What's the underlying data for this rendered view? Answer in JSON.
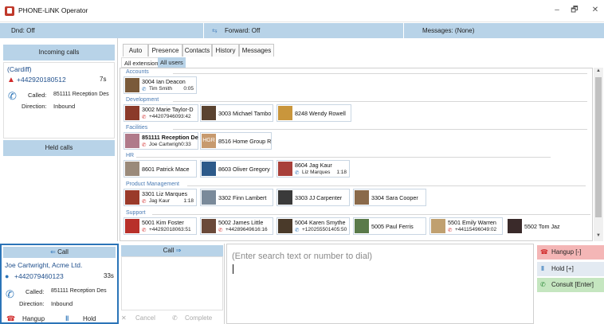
{
  "window": {
    "title": "PHONE-LiNK Operator",
    "minimize": "–",
    "maximize": "🗗",
    "close": "✕"
  },
  "status": {
    "dnd": "Dnd: Off",
    "forward": "Forward: Off",
    "messages": "Messages: (None)"
  },
  "left": {
    "incoming_header": "Incoming calls",
    "incoming": {
      "name": "(Cardiff)",
      "number": "+442920180512",
      "time": "7s",
      "called_label": "Called:",
      "called_value": "851111 Reception Des",
      "direction_label": "Direction:",
      "direction_value": "Inbound"
    },
    "held_header": "Held calls"
  },
  "tabs": [
    "Auto",
    "Presence",
    "Contacts",
    "History",
    "Messages"
  ],
  "subtabs": [
    "All extensions",
    "All users"
  ],
  "groups": [
    {
      "name": "Accounts",
      "users": [
        {
          "ext": "3004",
          "name": "Ian Deacon",
          "sub": "Tim Smith",
          "dur": "0:05"
        }
      ]
    },
    {
      "name": "Development",
      "users": [
        {
          "ext": "3002",
          "name": "Marie Taylor-D",
          "sub": "+442079460",
          "dur": "93:42"
        },
        {
          "ext": "3003",
          "name": "Michael Tambo",
          "sub": "",
          "dur": ""
        },
        {
          "ext": "8248",
          "name": "Wendy Rowell",
          "sub": "",
          "dur": ""
        }
      ]
    },
    {
      "name": "Facilities",
      "users": [
        {
          "ext": "851111",
          "name": "Reception De",
          "sub": "Joe Cartwrigh",
          "dur": "0:33"
        },
        {
          "ext": "8516",
          "name": "Home Group R",
          "sub": "",
          "dur": "",
          "initials": "HGR"
        }
      ]
    },
    {
      "name": "HR",
      "users": [
        {
          "ext": "8601",
          "name": "Patrick Mace",
          "sub": "",
          "dur": ""
        },
        {
          "ext": "8603",
          "name": "Oliver Gregory",
          "sub": "",
          "dur": ""
        },
        {
          "ext": "8604",
          "name": "Jag Kaur",
          "sub": "Liz Marques",
          "dur": "1:18"
        }
      ]
    },
    {
      "name": "Product Management",
      "users": [
        {
          "ext": "3301",
          "name": "Liz Marques",
          "sub": "Jag Kaur",
          "dur": "1:18"
        },
        {
          "ext": "3302",
          "name": "Finn Lambert",
          "sub": "",
          "dur": ""
        },
        {
          "ext": "3303",
          "name": "JJ Carpenter",
          "sub": "",
          "dur": ""
        },
        {
          "ext": "3304",
          "name": "Sara Cooper",
          "sub": "",
          "dur": ""
        }
      ]
    },
    {
      "name": "Support",
      "users": [
        {
          "ext": "5001",
          "name": "Kim Foster",
          "sub": "+44292018063",
          "dur": ":51"
        },
        {
          "ext": "5002",
          "name": "James Little",
          "sub": "+44289649616",
          "dur": ":16"
        },
        {
          "ext": "5004",
          "name": "Karen Smythe",
          "sub": "+12025550140",
          "dur": "5:50"
        },
        {
          "ext": "5005",
          "name": "Paul Ferris",
          "sub": "",
          "dur": ""
        },
        {
          "ext": "5501",
          "name": "Emily Warren",
          "sub": "+441154960",
          "dur": "49:02"
        },
        {
          "ext": "5502",
          "name": "Tom Jaz",
          "sub": "",
          "dur": ""
        }
      ]
    }
  ],
  "call": {
    "header": "Call",
    "caller": "Joe Cartwright, Acme Ltd.",
    "number": "+442079460123",
    "time": "33s",
    "called_label": "Called:",
    "called_value": "851111 Reception Des",
    "direction_label": "Direction:",
    "direction_value": "Inbound",
    "hangup": "Hangup",
    "hold": "Hold"
  },
  "call2": {
    "header": "Call",
    "cancel": "Cancel",
    "complete": "Complete"
  },
  "search": {
    "placeholder": "(Enter search text or number to dial)"
  },
  "actions": {
    "hangup": "Hangup [-]",
    "hold": "Hold [+]",
    "consult": "Consult [Enter]"
  },
  "colors": {
    "accent": "#b8d3e8",
    "selected_border": "#2b74b8",
    "hangup_bg": "#f4b6b6",
    "consult_bg": "#c5e6c0",
    "hold_bg": "#e3eaf2",
    "group_text": "#4a7bb4"
  }
}
